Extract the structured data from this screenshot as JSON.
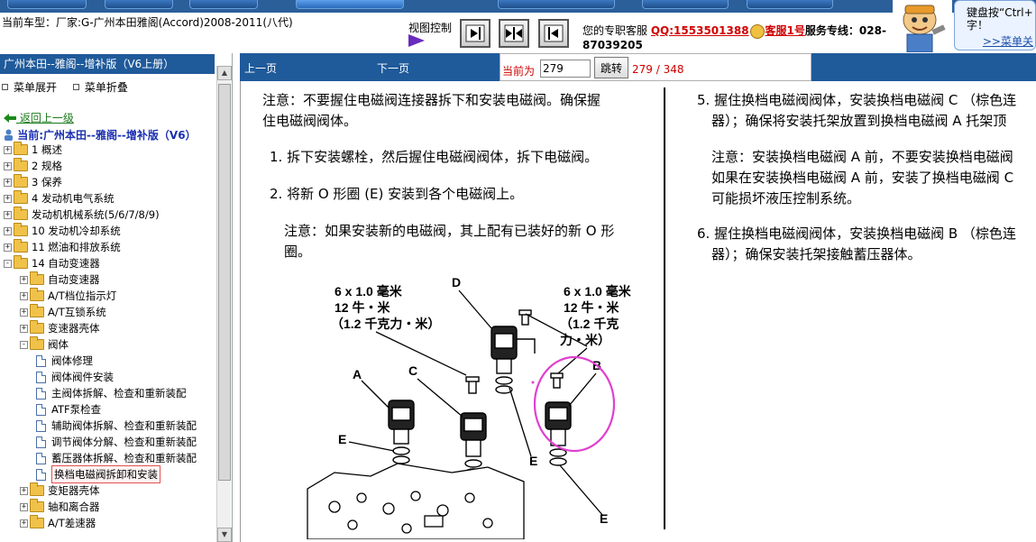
{
  "header": {
    "car_model": "当前车型：厂家:G-广州本田雅阁(Accord)2008-2011(八代)",
    "view_control_label": "视图控制",
    "service": {
      "prefix": "您的专职客服",
      "qq": "QQ:1553501388",
      "kefu": "客服1号",
      "hotline_label": "服务专线：028-",
      "hotline_rest": "87039205"
    },
    "tip": {
      "line1": "键盘按“Ctrl+",
      "line2": "字！",
      "more": ">>菜单关"
    }
  },
  "sidebar": {
    "title": "广州本田--雅阁--增补版（V6上册）",
    "expand_label": "菜单展开",
    "collapse_label": "菜单折叠",
    "back_label": "返回上一级",
    "current_label": "当前:广州本田--雅阁--增补版（V6）",
    "tree": [
      {
        "label": "1 概述",
        "level": 0,
        "type": "folder",
        "toggle": "+"
      },
      {
        "label": "2 规格",
        "level": 0,
        "type": "folder",
        "toggle": "+"
      },
      {
        "label": "3 保养",
        "level": 0,
        "type": "folder",
        "toggle": "+"
      },
      {
        "label": "4 发动机电气系统",
        "level": 0,
        "type": "folder",
        "toggle": "+"
      },
      {
        "label": "发动机机械系统(5/6/7/8/9)",
        "level": 0,
        "type": "folder",
        "toggle": "+"
      },
      {
        "label": "10 发动机冷却系统",
        "level": 0,
        "type": "folder",
        "toggle": "+"
      },
      {
        "label": "11 燃油和排放系统",
        "level": 0,
        "type": "folder",
        "toggle": "+"
      },
      {
        "label": "14 自动变速器",
        "level": 0,
        "type": "folder",
        "toggle": "-"
      },
      {
        "label": "自动变速器",
        "level": 1,
        "type": "folder",
        "toggle": "+"
      },
      {
        "label": "A/T档位指示灯",
        "level": 1,
        "type": "folder",
        "toggle": "+"
      },
      {
        "label": "A/T互锁系统",
        "level": 1,
        "type": "folder",
        "toggle": "+"
      },
      {
        "label": "变速器壳体",
        "level": 1,
        "type": "folder",
        "toggle": "+"
      },
      {
        "label": "阀体",
        "level": 1,
        "type": "folder",
        "toggle": "-"
      },
      {
        "label": "阀体修理",
        "level": 2,
        "type": "doc"
      },
      {
        "label": "阀体阀件安装",
        "level": 2,
        "type": "doc"
      },
      {
        "label": "主阀体拆解、检查和重新装配",
        "level": 2,
        "type": "doc"
      },
      {
        "label": "ATF泵检查",
        "level": 2,
        "type": "doc"
      },
      {
        "label": "辅助阀体拆解、检查和重新装配",
        "level": 2,
        "type": "doc"
      },
      {
        "label": "调节阀体分解、检查和重新装配",
        "level": 2,
        "type": "doc"
      },
      {
        "label": "蓄压器体拆解、检查和重新装配",
        "level": 2,
        "type": "doc"
      },
      {
        "label": "换档电磁阀拆卸和安装",
        "level": 2,
        "type": "doc",
        "selected": true
      },
      {
        "label": "变矩器壳体",
        "level": 1,
        "type": "folder",
        "toggle": "+"
      },
      {
        "label": "轴和离合器",
        "level": 1,
        "type": "folder",
        "toggle": "+"
      },
      {
        "label": "A/T差速器",
        "level": 1,
        "type": "folder",
        "toggle": "+"
      }
    ]
  },
  "nav": {
    "prev": "上一页",
    "next": "下一页",
    "current_label": "当前为",
    "page_value": "279",
    "goto": "跳转",
    "count": "279 / 348"
  },
  "content": {
    "left": {
      "note1_l1": "注意：不要握住电磁阀连接器拆下和安装电磁阀。确保握",
      "note1_l2": "住电磁阀阀体。",
      "step1": "1. 拆下安装螺栓，然后握住电磁阀阀体，拆下电磁阀。",
      "step2": "2. 将新 O 形圈 (E) 安装到各个电磁阀上。",
      "note2_l1": "注意：如果安装新的电磁阀，其上配有已装好的新 O 形",
      "note2_l2": "圈。"
    },
    "right": {
      "step5_l1": "5. 握住换档电磁阀阀体，安装换档电磁阀 C （棕色连",
      "step5_l2": "器）；确保将安装托架放置到换档电磁阀 A 托架顶",
      "note3_l1": "注意：安装换档电磁阀 A 前，不要安装换档电磁阀",
      "note3_l2": "如果在安装换档电磁阀 A 前，安装了换档电磁阀 C",
      "note3_l3": "可能损坏液压控制系统。",
      "step6_l1": "6. 握住换档电磁阀阀体，安装换档电磁阀 B （棕色连",
      "step6_l2": "器）；确保安装托架接触蓄压器体。"
    },
    "diagram": {
      "torque_left_l1": "6 x 1.0 毫米",
      "torque_left_l2": "12 牛・米",
      "torque_left_l3": "（1.2 千克力・米）",
      "torque_right_l1": "6 x 1.0 毫米",
      "torque_right_l2": "12 牛・米",
      "torque_right_l3": "（1.2 千克",
      "torque_right_l4": "力・米）",
      "label_a": "A",
      "label_b": "B",
      "label_c": "C",
      "label_d": "D",
      "label_e": "E"
    }
  },
  "colors": {
    "nav_blue": "#1f5a9a",
    "red_text": "#d00000",
    "highlight_circle": "#e040d0"
  }
}
